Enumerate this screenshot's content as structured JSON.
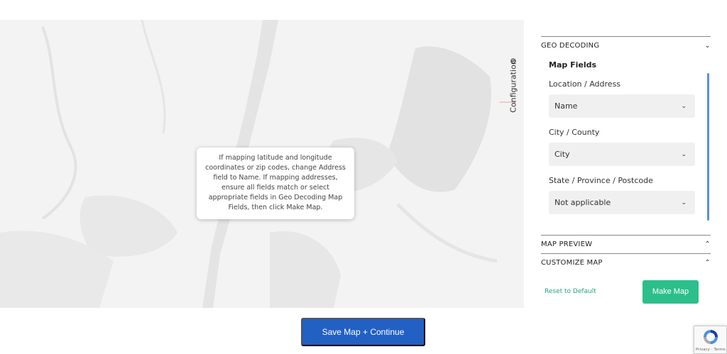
{
  "map": {
    "tooltip": "If mapping latitude and longitude coordinates or zip codes, change Address field to Name. If mapping addresses, ensure all fields match or select appropriate fields in Geo Decoding Map Fields, then click Make Map."
  },
  "config_tab": {
    "label": "Configuration",
    "icon": "gear-icon"
  },
  "panel": {
    "geo_decoding": {
      "title": "GEO DECODING",
      "fields_title": "Map Fields",
      "fields": [
        {
          "label": "Location / Address",
          "value": "Name"
        },
        {
          "label": "City / County",
          "value": "City"
        },
        {
          "label": "State / Province / Postcode",
          "value": "Not applicable"
        }
      ]
    },
    "map_preview": {
      "title": "MAP PREVIEW"
    },
    "customize_map": {
      "title": "CUSTOMIZE MAP"
    },
    "reset_label": "Reset to Default",
    "make_map_label": "Make Map"
  },
  "save_button": "Save Map + Continue",
  "recaptcha": {
    "text": "Privacy - Terms"
  },
  "colors": {
    "accent_green": "#2cbf8c",
    "primary_blue": "#2260c3",
    "arrow_red": "#e03030"
  }
}
